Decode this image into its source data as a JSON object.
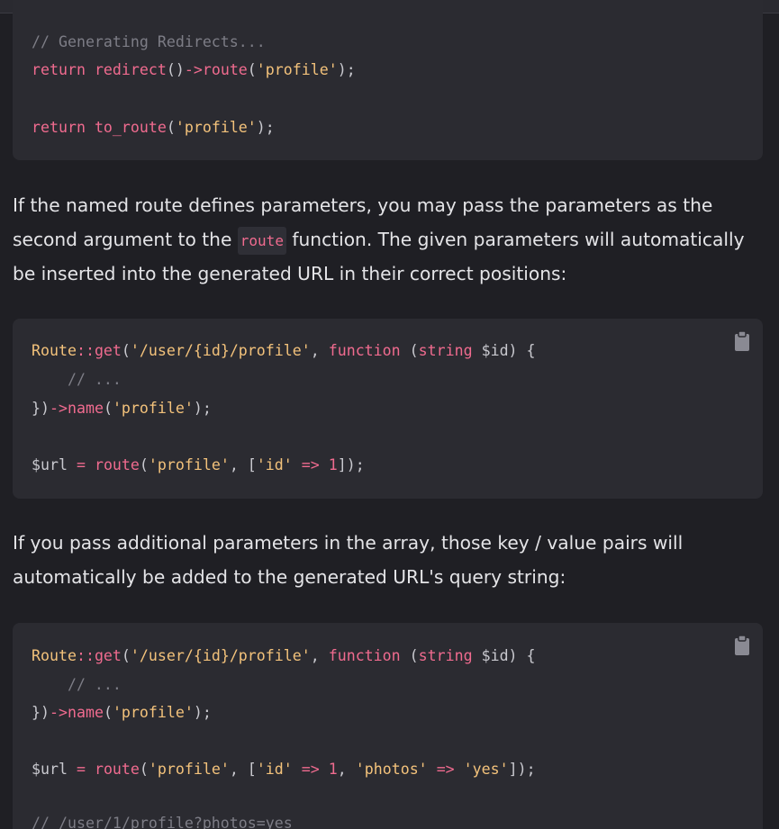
{
  "block1": {
    "lines": [
      [
        {
          "t": "// Generating Redirects...",
          "c": "comment"
        }
      ],
      [
        {
          "t": "return ",
          "c": "keyword"
        },
        {
          "t": "redirect",
          "c": "func"
        },
        {
          "t": "()",
          "c": "punct"
        },
        {
          "t": "->",
          "c": "op"
        },
        {
          "t": "route",
          "c": "func"
        },
        {
          "t": "(",
          "c": "punct"
        },
        {
          "t": "'profile'",
          "c": "string"
        },
        {
          "t": ");",
          "c": "punct"
        }
      ],
      [],
      [
        {
          "t": "return ",
          "c": "keyword"
        },
        {
          "t": "to_route",
          "c": "func"
        },
        {
          "t": "(",
          "c": "punct"
        },
        {
          "t": "'profile'",
          "c": "string"
        },
        {
          "t": ");",
          "c": "punct"
        }
      ]
    ]
  },
  "para1": {
    "before": "If the named route defines parameters, you may pass the parameters as the second argument to the ",
    "code": "route",
    "after": " function. The given parameters will automatically be inserted into the generated URL in their correct positions:"
  },
  "block2": {
    "lines": [
      [
        {
          "t": "Route",
          "c": "class"
        },
        {
          "t": "::",
          "c": "op"
        },
        {
          "t": "get",
          "c": "func"
        },
        {
          "t": "(",
          "c": "punct"
        },
        {
          "t": "'/user/{id}/profile'",
          "c": "string"
        },
        {
          "t": ", ",
          "c": "punct"
        },
        {
          "t": "function",
          "c": "type"
        },
        {
          "t": " (",
          "c": "punct"
        },
        {
          "t": "string",
          "c": "type"
        },
        {
          "t": " $id) {",
          "c": "plain"
        }
      ],
      [
        {
          "t": "    // ...",
          "c": "comment"
        }
      ],
      [
        {
          "t": "})",
          "c": "punct"
        },
        {
          "t": "->",
          "c": "op"
        },
        {
          "t": "name",
          "c": "func"
        },
        {
          "t": "(",
          "c": "punct"
        },
        {
          "t": "'profile'",
          "c": "string"
        },
        {
          "t": ");",
          "c": "punct"
        }
      ],
      [],
      [
        {
          "t": "$url ",
          "c": "plain"
        },
        {
          "t": "=",
          "c": "op"
        },
        {
          "t": " ",
          "c": "plain"
        },
        {
          "t": "route",
          "c": "func"
        },
        {
          "t": "(",
          "c": "punct"
        },
        {
          "t": "'profile'",
          "c": "string"
        },
        {
          "t": ", [",
          "c": "punct"
        },
        {
          "t": "'id'",
          "c": "string"
        },
        {
          "t": " ",
          "c": "plain"
        },
        {
          "t": "=>",
          "c": "op"
        },
        {
          "t": " ",
          "c": "plain"
        },
        {
          "t": "1",
          "c": "number"
        },
        {
          "t": "]);",
          "c": "punct"
        }
      ]
    ]
  },
  "para2": {
    "text": "If you pass additional parameters in the array, those key / value pairs will automatically be added to the generated URL's query string:"
  },
  "block3": {
    "lines": [
      [
        {
          "t": "Route",
          "c": "class"
        },
        {
          "t": "::",
          "c": "op"
        },
        {
          "t": "get",
          "c": "func"
        },
        {
          "t": "(",
          "c": "punct"
        },
        {
          "t": "'/user/{id}/profile'",
          "c": "string"
        },
        {
          "t": ", ",
          "c": "punct"
        },
        {
          "t": "function",
          "c": "type"
        },
        {
          "t": " (",
          "c": "punct"
        },
        {
          "t": "string",
          "c": "type"
        },
        {
          "t": " $id) {",
          "c": "plain"
        }
      ],
      [
        {
          "t": "    // ...",
          "c": "comment"
        }
      ],
      [
        {
          "t": "})",
          "c": "punct"
        },
        {
          "t": "->",
          "c": "op"
        },
        {
          "t": "name",
          "c": "func"
        },
        {
          "t": "(",
          "c": "punct"
        },
        {
          "t": "'profile'",
          "c": "string"
        },
        {
          "t": ");",
          "c": "punct"
        }
      ],
      [],
      [
        {
          "t": "$url ",
          "c": "plain"
        },
        {
          "t": "=",
          "c": "op"
        },
        {
          "t": " ",
          "c": "plain"
        },
        {
          "t": "route",
          "c": "func"
        },
        {
          "t": "(",
          "c": "punct"
        },
        {
          "t": "'profile'",
          "c": "string"
        },
        {
          "t": ", [",
          "c": "punct"
        },
        {
          "t": "'id'",
          "c": "string"
        },
        {
          "t": " ",
          "c": "plain"
        },
        {
          "t": "=>",
          "c": "op"
        },
        {
          "t": " ",
          "c": "plain"
        },
        {
          "t": "1",
          "c": "number"
        },
        {
          "t": ", ",
          "c": "punct"
        },
        {
          "t": "'photos'",
          "c": "string"
        },
        {
          "t": " ",
          "c": "plain"
        },
        {
          "t": "=>",
          "c": "op"
        },
        {
          "t": " ",
          "c": "plain"
        },
        {
          "t": "'yes'",
          "c": "string"
        },
        {
          "t": "]);",
          "c": "punct"
        }
      ],
      [],
      [
        {
          "t": "// /user/1/profile?photos=yes",
          "c": "comment"
        }
      ]
    ]
  },
  "icons": {
    "copy": "clipboard-icon"
  }
}
